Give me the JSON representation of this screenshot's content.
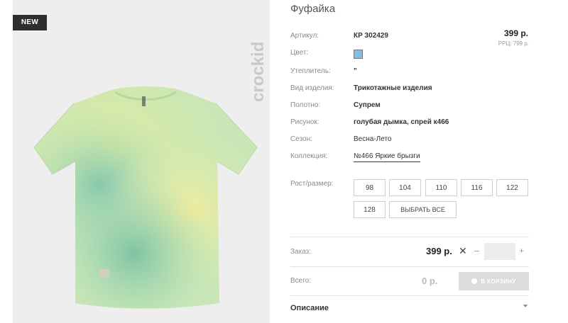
{
  "badge": "NEW",
  "logo_text": "crockid",
  "product": {
    "title": "Фуфайка",
    "price": "399 р.",
    "rrp": "РРЦ: 799 р."
  },
  "details": {
    "article": {
      "label": "Артикул:",
      "value": "КР 302429"
    },
    "color": {
      "label": "Цвет:",
      "swatch": "#80bde8"
    },
    "insulation": {
      "label": "Утеплитель:",
      "value": "\""
    },
    "type": {
      "label": "Вид изделия:",
      "value": "Трикотажные изделия"
    },
    "fabric": {
      "label": "Полотно:",
      "value": "Супрем"
    },
    "pattern": {
      "label": "Рисунок:",
      "value": "голубая дымка, спрей к466"
    },
    "season": {
      "label": "Сезон:",
      "value": "Весна-Лето"
    },
    "collection": {
      "label": "Коллекция:",
      "value": "№466 Яркие брызги"
    }
  },
  "sizes": {
    "label": "Рост/размер:",
    "options": [
      "98",
      "104",
      "110",
      "116",
      "122",
      "128"
    ],
    "select_all": "ВЫБРАТЬ ВСЕ"
  },
  "order": {
    "label": "Заказ:",
    "price": "399 р.",
    "times": "✕",
    "minus": "–",
    "plus": "+",
    "qty": ""
  },
  "total": {
    "label": "Всего:",
    "value": "0 р.",
    "cart_button": "В КОРЗИНУ"
  },
  "description": {
    "label": "Описание"
  }
}
